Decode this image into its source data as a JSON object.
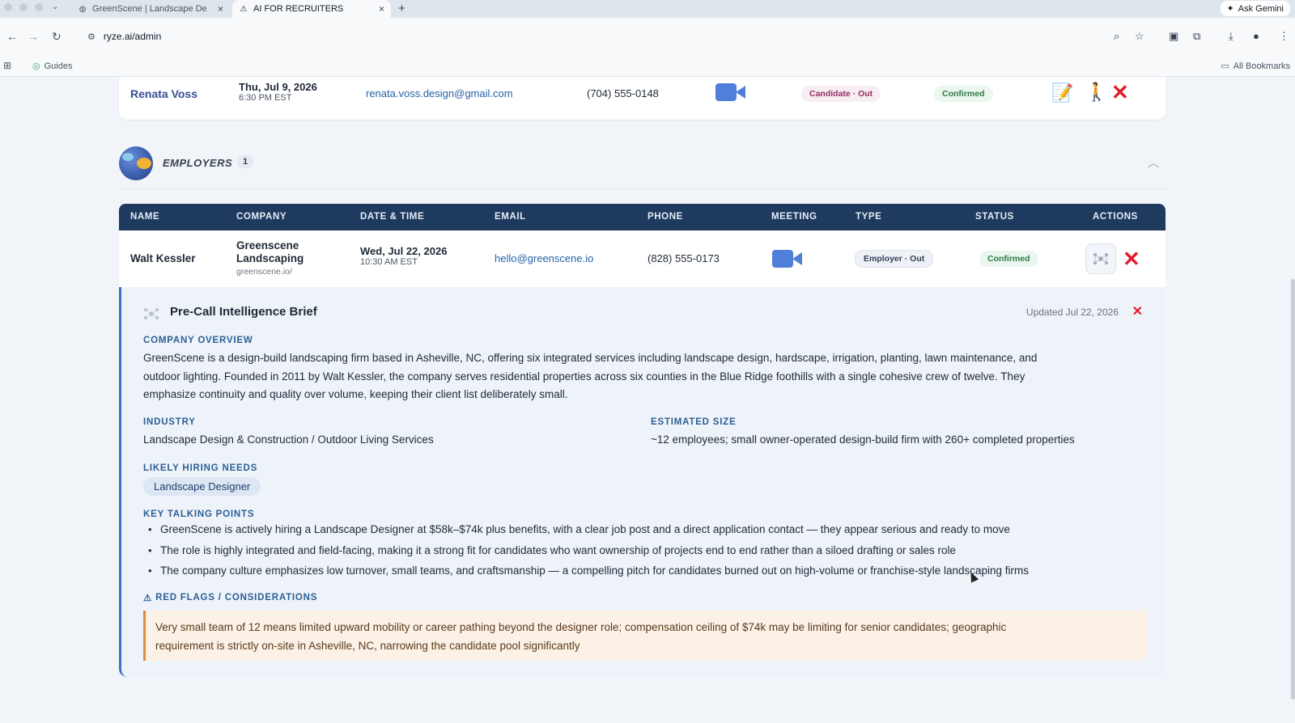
{
  "browser": {
    "tabs": [
      {
        "title": "GreenScene | Landscape De",
        "active": false
      },
      {
        "title": "AI FOR RECRUITERS",
        "active": true
      }
    ],
    "gemini_label": "Ask Gemini",
    "url": "ryze.ai/admin",
    "bookmarks": {
      "guides": "Guides",
      "all": "All Bookmarks"
    }
  },
  "candidate_row": {
    "name": "Renata Voss",
    "date": "Thu, Jul 9, 2026",
    "time": "6:30 PM EST",
    "email": "renata.voss.design@gmail.com",
    "phone": "(704) 555-0148",
    "type": "Candidate · Out",
    "status": "Confirmed"
  },
  "employers": {
    "title": "EMPLOYERS",
    "count": "1",
    "columns": [
      "NAME",
      "COMPANY",
      "DATE & TIME",
      "EMAIL",
      "PHONE",
      "MEETING",
      "TYPE",
      "STATUS",
      "ACTIONS"
    ],
    "row": {
      "name": "Walt Kessler",
      "company_line1": "Greenscene",
      "company_line2": "Landscaping",
      "company_site": "greenscene.io/",
      "date": "Wed, Jul 22, 2026",
      "time": "10:30 AM EST",
      "email": "hello@greenscene.io",
      "phone": "(828) 555-0173",
      "type": "Employer · Out",
      "status": "Confirmed"
    }
  },
  "brief": {
    "title": "Pre-Call Intelligence Brief",
    "updated": "Updated Jul 22, 2026",
    "company_overview_label": "COMPANY OVERVIEW",
    "company_overview_lines": [
      "GreenScene is a design-build landscaping firm based in Asheville, NC, offering six integrated services including landscape design, hardscape, irrigation, planting, lawn maintenance, and",
      "outdoor lighting. Founded in 2011 by Walt Kessler, the company serves residential properties across six counties in the Blue Ridge foothills with a single cohesive crew of twelve. They",
      "emphasize continuity and quality over volume, keeping their client list deliberately small."
    ],
    "industry_label": "INDUSTRY",
    "industry": "Landscape Design & Construction / Outdoor Living Services",
    "size_label": "ESTIMATED SIZE",
    "size": "~12 employees; small owner-operated design-build firm with 260+ completed properties",
    "hiring_label": "LIKELY HIRING NEEDS",
    "hiring_tag": "Landscape Designer",
    "talking_label": "KEY TALKING POINTS",
    "talking_points": [
      "GreenScene is actively hiring a Landscape Designer at $58k–$74k plus benefits, with a clear job post and a direct application contact — they appear serious and ready to move",
      "The role is highly integrated and field-facing, making it a strong fit for candidates who want ownership of projects end to end rather than a siloed drafting or sales role",
      "The company culture emphasizes low turnover, small teams, and craftsmanship — a compelling pitch for candidates burned out on high-volume or franchise-style landscaping firms"
    ],
    "flags_label": "RED FLAGS / CONSIDERATIONS",
    "flags_lines": [
      "Very small team of 12 means limited upward mobility or career pathing beyond the designer role; compensation ceiling of $74k may be limiting for senior candidates; geographic",
      "requirement is strictly on-site in Asheville, NC, narrowing the candidate pool significantly"
    ]
  },
  "colors": {
    "table_header": "#1e3a5f",
    "accent_blue": "#3f6fc2",
    "delete_red": "#e11d2a",
    "confirmed_green": "#2f7a45"
  }
}
